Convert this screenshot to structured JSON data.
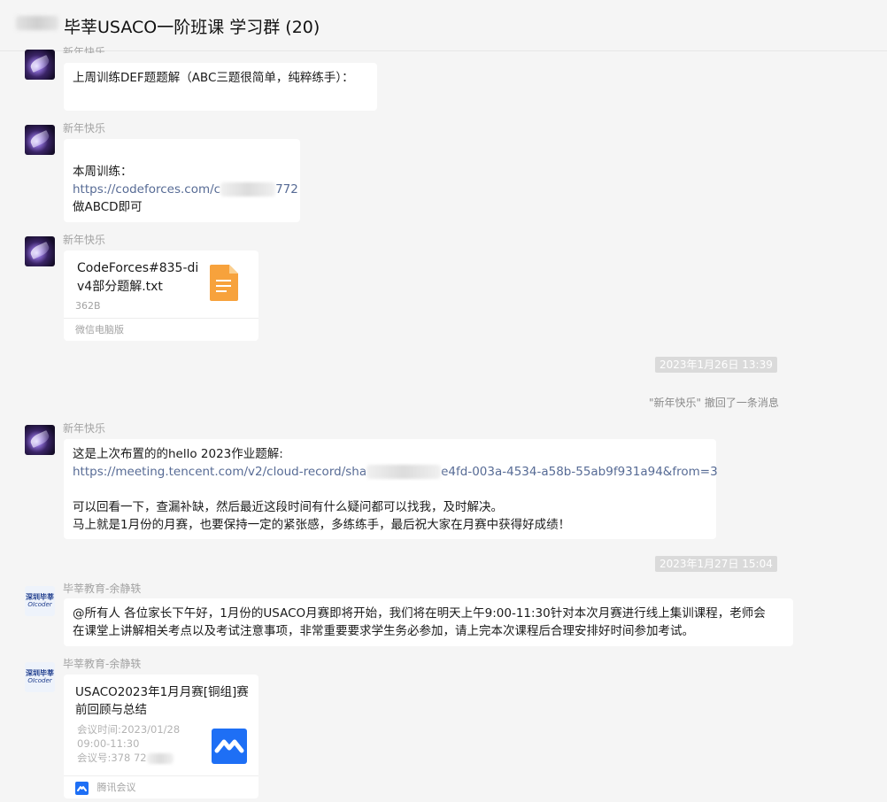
{
  "header": {
    "title": "毕莘USACO一阶班课 学习群 (20)"
  },
  "messages": {
    "m1": {
      "sender": "新年快乐",
      "text": "上周训练DEF题题解（ABC三题很简单，纯粹练手）："
    },
    "m2": {
      "sender": "新年快乐",
      "line1": "本周训练：",
      "link_start": "https://codeforces.com/c",
      "link_end": "772",
      "line3": "做ABCD即可"
    },
    "m3": {
      "sender": "新年快乐",
      "file_name_line1": "CodeForces#835-di",
      "file_name_line2": "v4部分题解.txt",
      "file_size": "362B",
      "source": "微信电脑版",
      "file_icon": "txt-file-icon"
    },
    "time1": "2023年1月26日 13:39",
    "recall": "\"新年快乐\" 撤回了一条消息",
    "m4": {
      "sender": "新年快乐",
      "line1": "这是上次布置的的hello 2023作业题解:",
      "link_start": "https://meeting.tencent.com/v2/cloud-record/sha",
      "link_end": "e4fd-003a-4534-a58b-55ab9f931a94&from=3",
      "line3": "可以回看一下，查漏补缺，然后最近这段时间有什么疑问都可以找我，及时解决。",
      "line4": "马上就是1月份的月赛，也要保持一定的紧张感，多练练手，最后祝大家在月赛中获得好成绩！"
    },
    "time2": "2023年1月27日 15:04",
    "m5": {
      "sender": "毕莘教育-余静轶",
      "line1": "@所有人  各位家长下午好，1月份的USACO月赛即将开始，我们将在明天上午9:00-11:30针对本次月赛进行线上集训课程，老师会",
      "line2": "在课堂上讲解相关考点以及考试注意事项，非常重要要求学生务必参加，请上完本次课程后合理安排好时间参加考试。"
    },
    "m6": {
      "sender": "毕莘教育-余静轶",
      "title_line1": "USACO2023年1月月赛[铜组]赛",
      "title_line2": "前回顾与总结",
      "time_line1": "会议时间:2023/01/28",
      "time_line2": "09:00-11:30",
      "meeting_id": "会议号:378 72",
      "source": "腾讯会议",
      "app_icon": "tencent-meeting-icon"
    }
  },
  "avatar_org": {
    "line1": "深圳毕莘",
    "line2": "OIcoder"
  },
  "colors": {
    "link": "#576b95",
    "background": "#f5f5f5",
    "bubble": "#ffffff",
    "file_orange": "#f7a23c",
    "meeting_blue": "#1e6ff5"
  }
}
